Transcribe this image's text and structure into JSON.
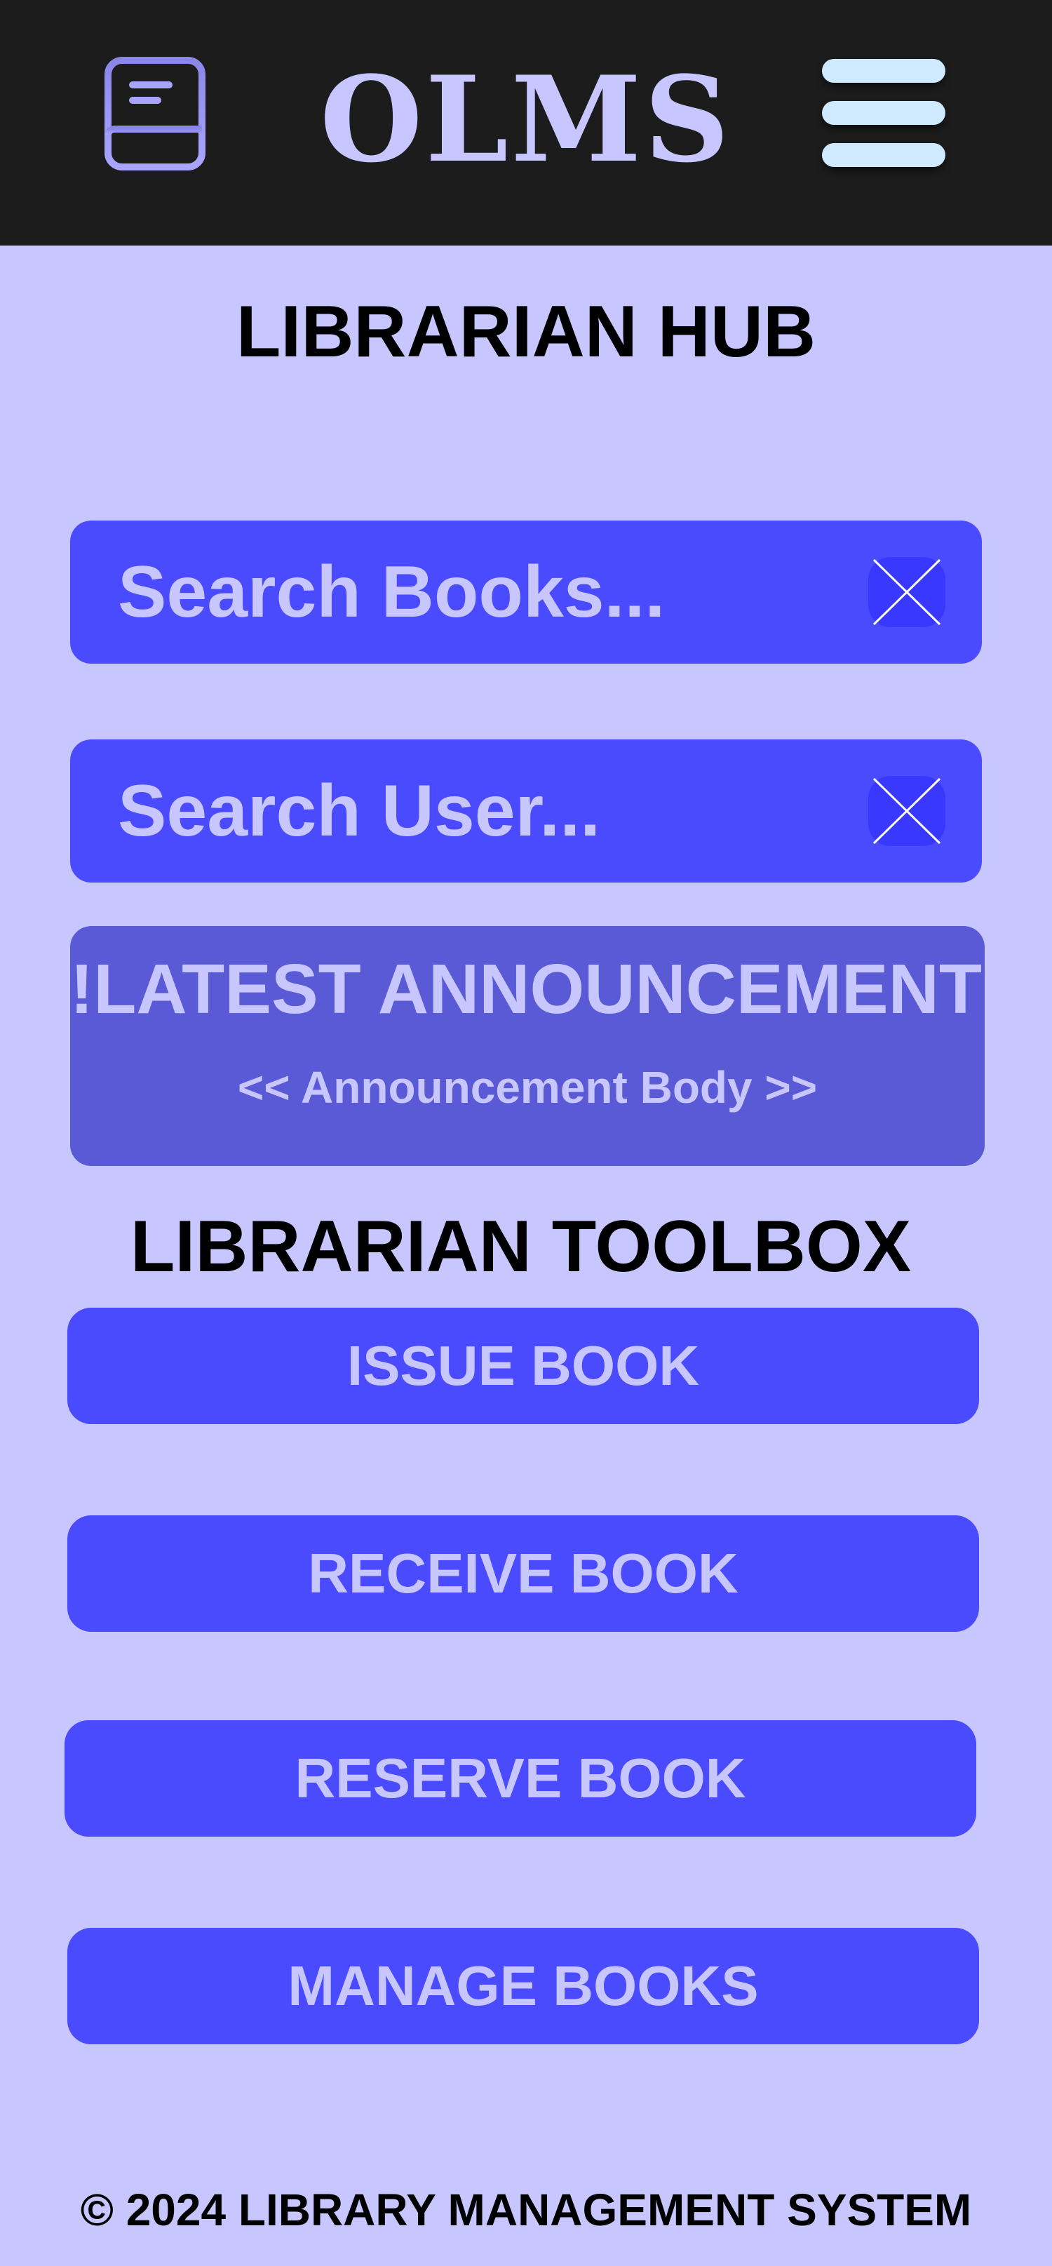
{
  "header": {
    "app_title": "OLMS",
    "logo_icon": "book-icon",
    "menu_icon": "hamburger-menu-icon",
    "background_color": "#1c1c1c",
    "title_color": "#c8c6ff"
  },
  "main": {
    "hub_title": "LIBRARIAN HUB",
    "search_books": {
      "placeholder": "Search Books...",
      "clear_icon": "close-icon"
    },
    "search_user": {
      "placeholder": "Search User...",
      "clear_icon": "close-icon"
    },
    "announcement": {
      "title": "!LATEST ANNOUNCEMENT!",
      "body": "<< Announcement Body >>"
    },
    "toolbox_title": "LIBRARIAN TOOLBOX",
    "tools": [
      {
        "label": "ISSUE BOOK"
      },
      {
        "label": "RECEIVE BOOK"
      },
      {
        "label": "RESERVE BOOK"
      },
      {
        "label": "MANAGE BOOKS"
      }
    ]
  },
  "footer": {
    "text": "© 2024 LIBRARY MANAGEMENT SYSTEM"
  },
  "colors": {
    "page_background": "#c8c6ff",
    "accent": "#4a4aff",
    "announcement_background": "#5a5ad6",
    "text_light": "#c8c6ff"
  }
}
